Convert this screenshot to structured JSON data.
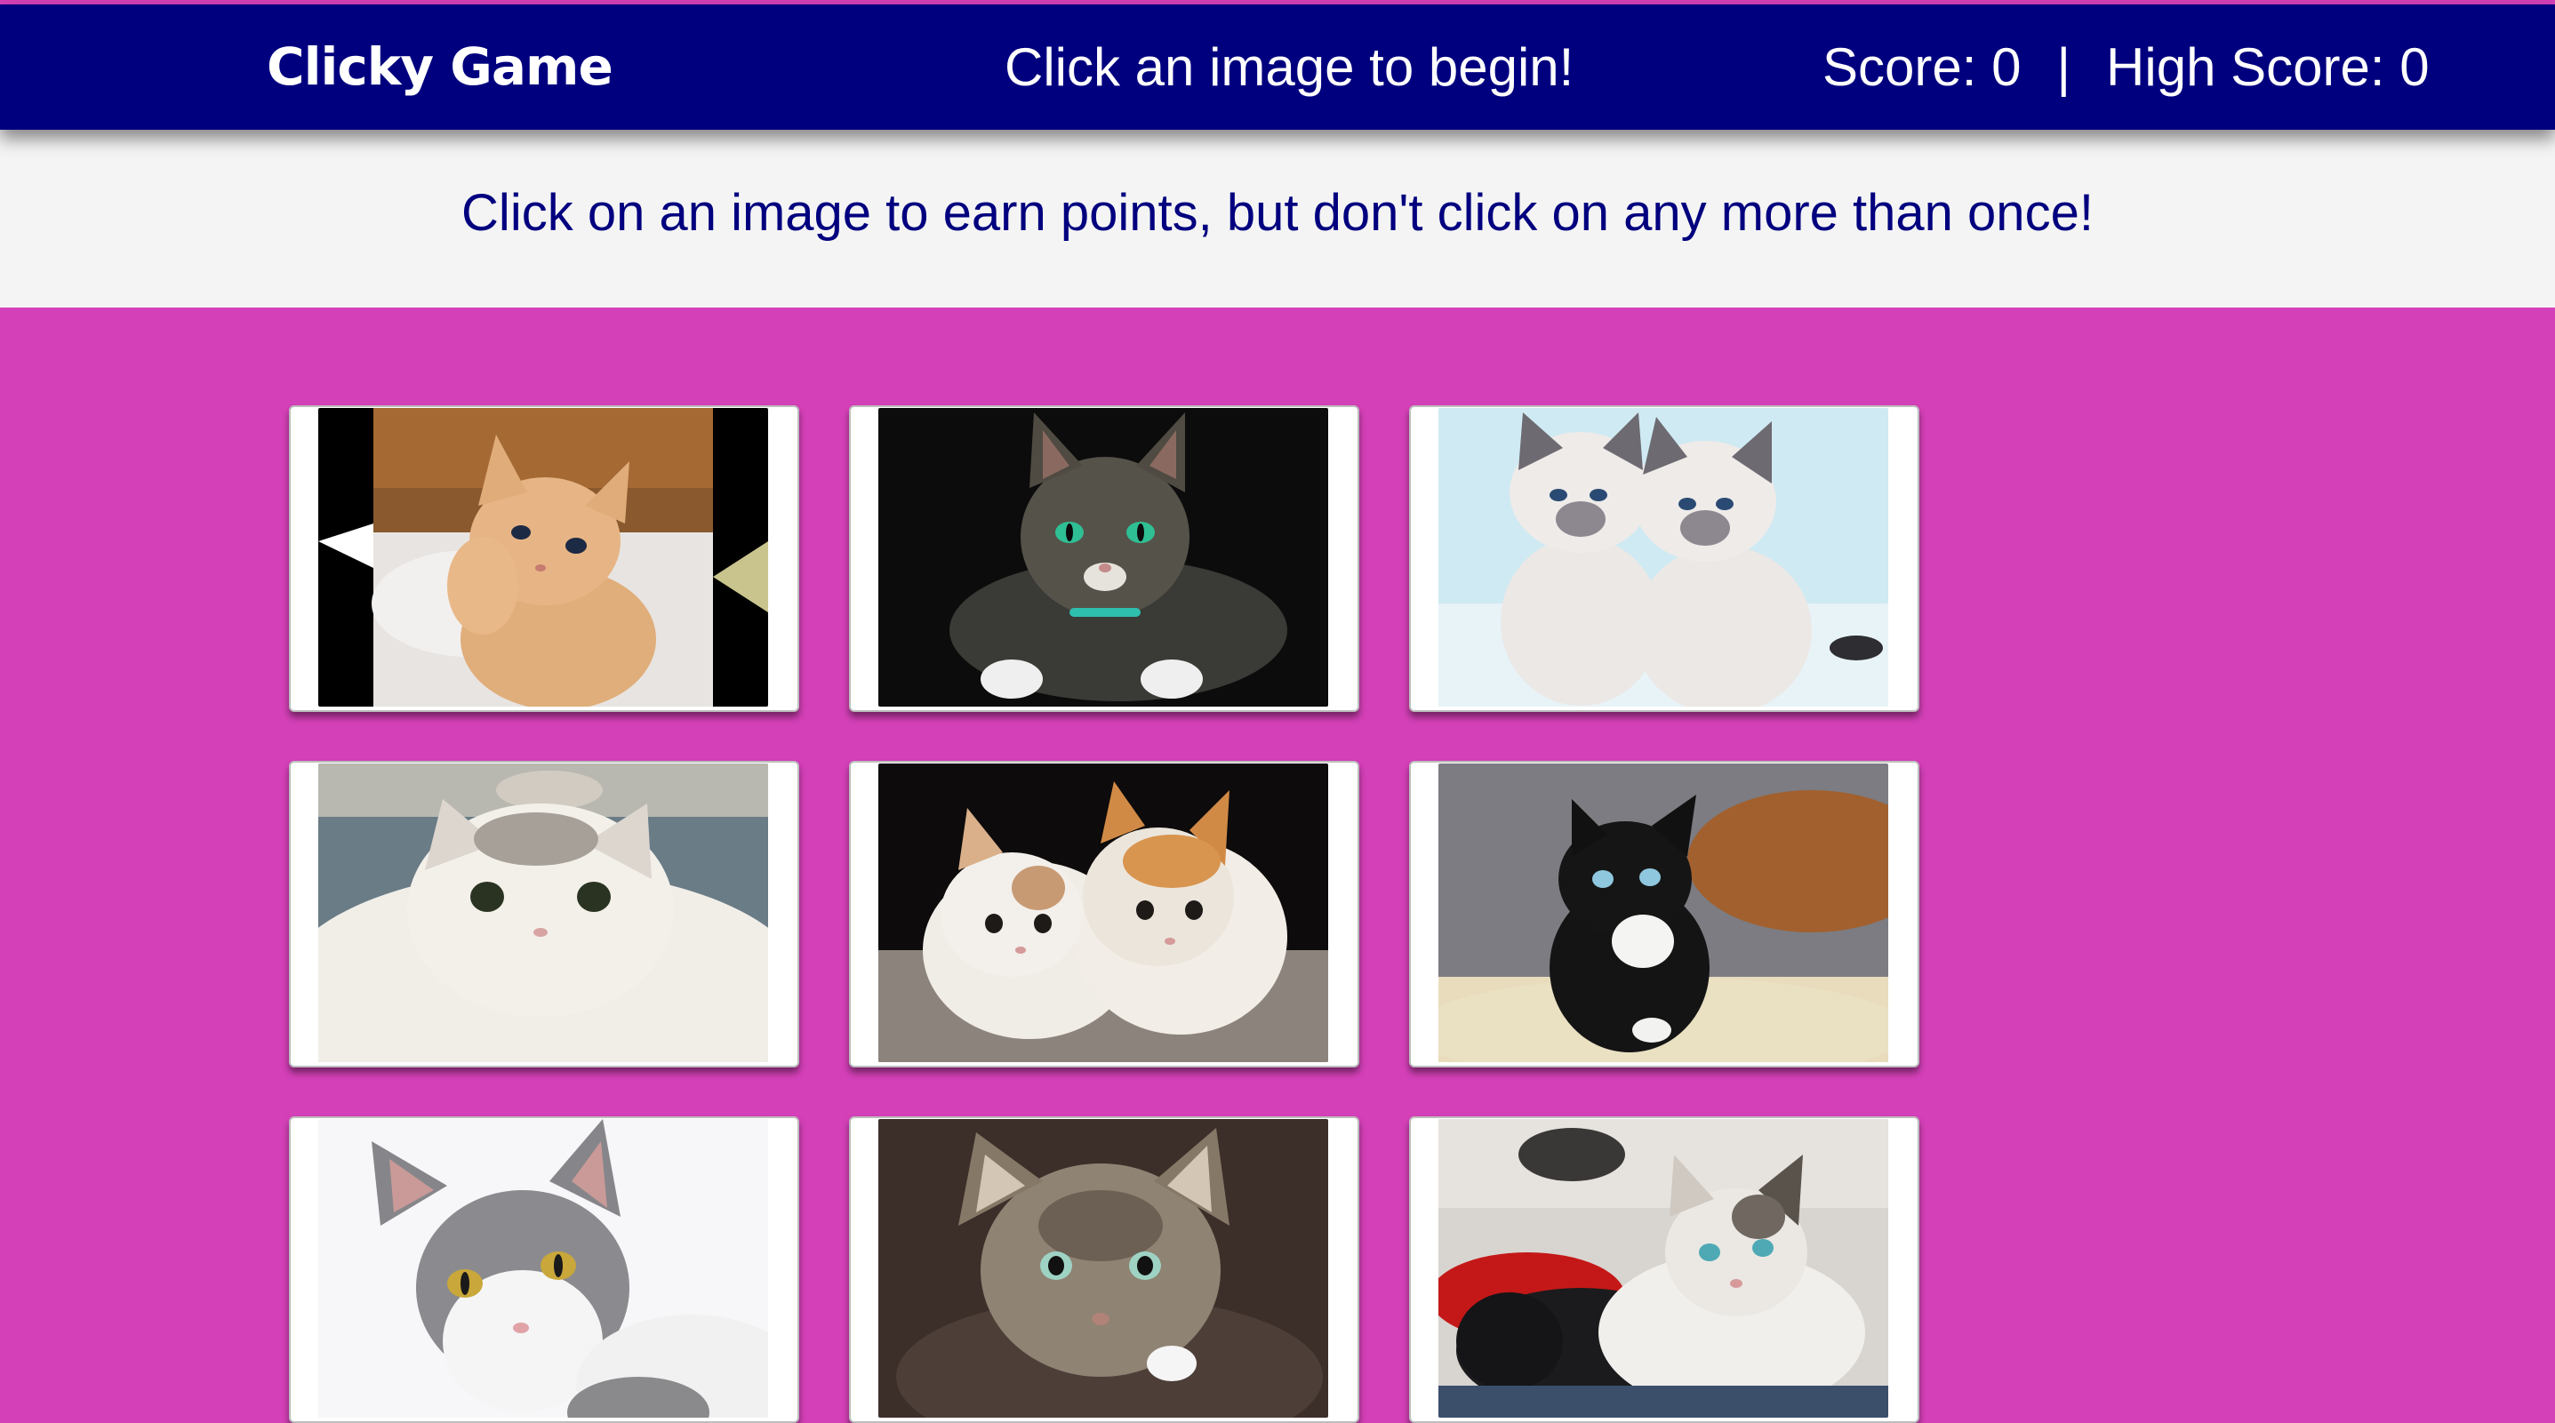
{
  "navbar": {
    "brand": "Clicky Game",
    "status_message": "Click an image to begin!",
    "score_label": "Score: 0",
    "separator": "|",
    "high_score_label": "High Score: 0"
  },
  "jumbotron": {
    "instruction": "Click on an image to earn points, but don't click on any more than once!"
  },
  "colors": {
    "navbar_bg": "#00007f",
    "page_bg": "#d440b8",
    "jumbotron_bg": "#f4f4f4",
    "text_accent": "#00007f"
  },
  "cards": [
    {
      "subject": "orange-kitten-on-pillow"
    },
    {
      "subject": "tabby-cat-dark-background"
    },
    {
      "subject": "two-siamese-kittens"
    },
    {
      "subject": "fluffy-white-cat"
    },
    {
      "subject": "two-kittens-lying"
    },
    {
      "subject": "black-white-kitten-in-basket"
    },
    {
      "subject": "grey-white-cat"
    },
    {
      "subject": "tabby-cat-green-eyes"
    },
    {
      "subject": "kittens-on-red-blanket"
    }
  ]
}
